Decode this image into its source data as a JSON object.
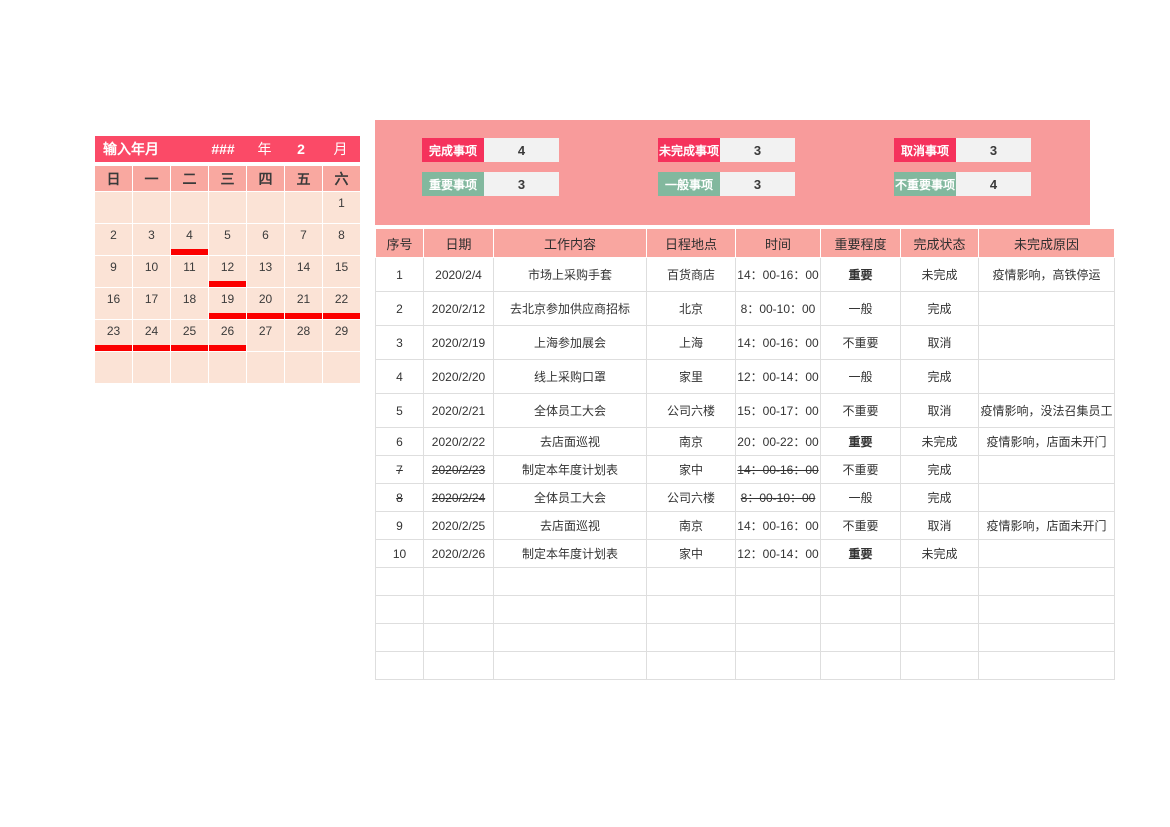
{
  "calendar": {
    "title_label": "输入年月",
    "year_value": "###",
    "year_unit": "年",
    "month_value": "2",
    "month_unit": "月",
    "weekdays": [
      "日",
      "一",
      "二",
      "三",
      "四",
      "五",
      "六"
    ],
    "weeks": [
      [
        {
          "day": "",
          "marked": false
        },
        {
          "day": "",
          "marked": false
        },
        {
          "day": "",
          "marked": false
        },
        {
          "day": "",
          "marked": false
        },
        {
          "day": "",
          "marked": false
        },
        {
          "day": "",
          "marked": false
        },
        {
          "day": "1",
          "marked": false
        }
      ],
      [
        {
          "day": "2",
          "marked": false
        },
        {
          "day": "3",
          "marked": false
        },
        {
          "day": "4",
          "marked": true
        },
        {
          "day": "5",
          "marked": false
        },
        {
          "day": "6",
          "marked": false
        },
        {
          "day": "7",
          "marked": false
        },
        {
          "day": "8",
          "marked": false
        }
      ],
      [
        {
          "day": "9",
          "marked": false
        },
        {
          "day": "10",
          "marked": false
        },
        {
          "day": "11",
          "marked": false
        },
        {
          "day": "12",
          "marked": true
        },
        {
          "day": "13",
          "marked": false
        },
        {
          "day": "14",
          "marked": false
        },
        {
          "day": "15",
          "marked": false
        }
      ],
      [
        {
          "day": "16",
          "marked": false
        },
        {
          "day": "17",
          "marked": false
        },
        {
          "day": "18",
          "marked": false
        },
        {
          "day": "19",
          "marked": true
        },
        {
          "day": "20",
          "marked": true
        },
        {
          "day": "21",
          "marked": true
        },
        {
          "day": "22",
          "marked": true
        }
      ],
      [
        {
          "day": "23",
          "marked": true
        },
        {
          "day": "24",
          "marked": true
        },
        {
          "day": "25",
          "marked": true
        },
        {
          "day": "26",
          "marked": true
        },
        {
          "day": "27",
          "marked": false
        },
        {
          "day": "28",
          "marked": false
        },
        {
          "day": "29",
          "marked": false
        }
      ],
      [
        {
          "day": "",
          "marked": false
        },
        {
          "day": "",
          "marked": false
        },
        {
          "day": "",
          "marked": false
        },
        {
          "day": "",
          "marked": false
        },
        {
          "day": "",
          "marked": false
        },
        {
          "day": "",
          "marked": false
        },
        {
          "day": "",
          "marked": false
        }
      ]
    ]
  },
  "stats": {
    "cells": [
      {
        "label": "完成事项",
        "value": "4",
        "style": "red"
      },
      {
        "label": "未完成事项",
        "value": "3",
        "style": "red"
      },
      {
        "label": "取消事项",
        "value": "3",
        "style": "red"
      },
      {
        "label": "重要事项",
        "value": "3",
        "style": "green"
      },
      {
        "label": "一般事项",
        "value": "3",
        "style": "green"
      },
      {
        "label": "不重要事项",
        "value": "4",
        "style": "green"
      }
    ]
  },
  "table": {
    "headers": [
      "序号",
      "日期",
      "工作内容",
      "日程地点",
      "时间",
      "重要程度",
      "完成状态",
      "未完成原因"
    ],
    "rows": [
      {
        "idx": "1",
        "date": "2020/2/4",
        "work": "市场上采购手套",
        "place": "百货商店",
        "time": "14：00-16：00",
        "importance": "重要",
        "imp_level": "high",
        "status": "未完成",
        "reason": "疫情影响，高铁停运",
        "strike": false
      },
      {
        "idx": "2",
        "date": "2020/2/12",
        "work": "去北京参加供应商招标",
        "place": "北京",
        "time": "8：00-10：00",
        "importance": "一般",
        "imp_level": "mid",
        "status": "完成",
        "reason": "",
        "strike": false
      },
      {
        "idx": "3",
        "date": "2020/2/19",
        "work": "上海参加展会",
        "place": "上海",
        "time": "14：00-16：00",
        "importance": "不重要",
        "imp_level": "low",
        "status": "取消",
        "reason": "",
        "strike": false
      },
      {
        "idx": "4",
        "date": "2020/2/20",
        "work": "线上采购口罩",
        "place": "家里",
        "time": "12：00-14：00",
        "importance": "一般",
        "imp_level": "mid",
        "status": "完成",
        "reason": "",
        "strike": false
      },
      {
        "idx": "5",
        "date": "2020/2/21",
        "work": "全体员工大会",
        "place": "公司六楼",
        "time": "15：00-17：00",
        "importance": "不重要",
        "imp_level": "low",
        "status": "取消",
        "reason": "疫情影响，没法召集员工",
        "strike": false
      },
      {
        "idx": "6",
        "date": "2020/2/22",
        "work": "去店面巡视",
        "place": "南京",
        "time": "20：00-22：00",
        "importance": "重要",
        "imp_level": "high",
        "status": "未完成",
        "reason": "疫情影响，店面未开门",
        "strike": false
      },
      {
        "idx": "7",
        "date": "2020/2/23",
        "work": "制定本年度计划表",
        "place": "家中",
        "time": "14：00-16：00",
        "importance": "不重要",
        "imp_level": "low",
        "status": "完成",
        "reason": "",
        "strike": true
      },
      {
        "idx": "8",
        "date": "2020/2/24",
        "work": "全体员工大会",
        "place": "公司六楼",
        "time": "8：00-10：00",
        "importance": "一般",
        "imp_level": "mid",
        "status": "完成",
        "reason": "",
        "strike": true
      },
      {
        "idx": "9",
        "date": "2020/2/25",
        "work": "去店面巡视",
        "place": "南京",
        "time": "14：00-16：00",
        "importance": "不重要",
        "imp_level": "low",
        "status": "取消",
        "reason": "疫情影响，店面未开门",
        "strike": false
      },
      {
        "idx": "10",
        "date": "2020/2/26",
        "work": "制定本年度计划表",
        "place": "家中",
        "time": "12：00-14：00",
        "importance": "重要",
        "imp_level": "high",
        "status": "未完成",
        "reason": "",
        "strike": false
      }
    ],
    "empty_row_count": 4
  },
  "colors": {
    "title_bar": "#fb4a67",
    "weekday_header": "#f9a8a0",
    "day_cell": "#fbe3d6",
    "marker": "#fb0000",
    "stats_panel": "#f89b9b",
    "badge_red": "#f5325c",
    "badge_green": "#82b89e",
    "table_header": "#f9a6a0",
    "importance_high": "#fb3a5c",
    "importance_mid": "#6fae93"
  }
}
